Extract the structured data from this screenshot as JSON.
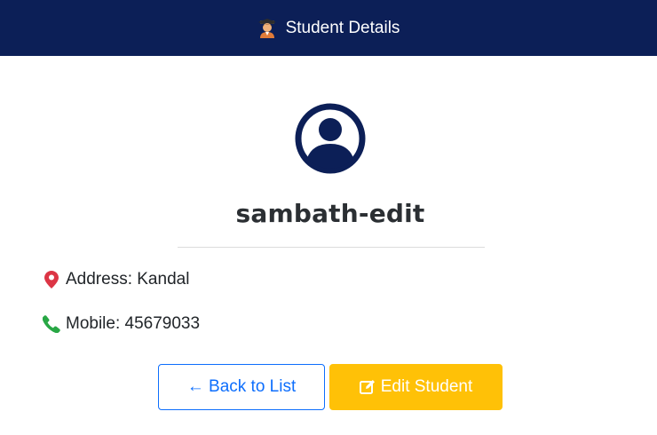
{
  "header": {
    "icon": "student-icon",
    "title": "Student Details"
  },
  "profile": {
    "avatar_icon": "user-circle-icon",
    "name": "sambath-edit"
  },
  "details": {
    "address_label": "Address: Kandal",
    "address_icon": "map-pin-icon",
    "mobile_label": "Mobile: 45679033",
    "mobile_icon": "phone-icon"
  },
  "actions": {
    "back_label": "← Back to List",
    "edit_label": "Edit Student",
    "edit_icon": "edit-icon"
  },
  "colors": {
    "header_bg": "#0c1f57",
    "primary": "#0d6efd",
    "warning": "#ffc107",
    "address_icon": "#dc3545",
    "mobile_icon": "#28a745"
  }
}
